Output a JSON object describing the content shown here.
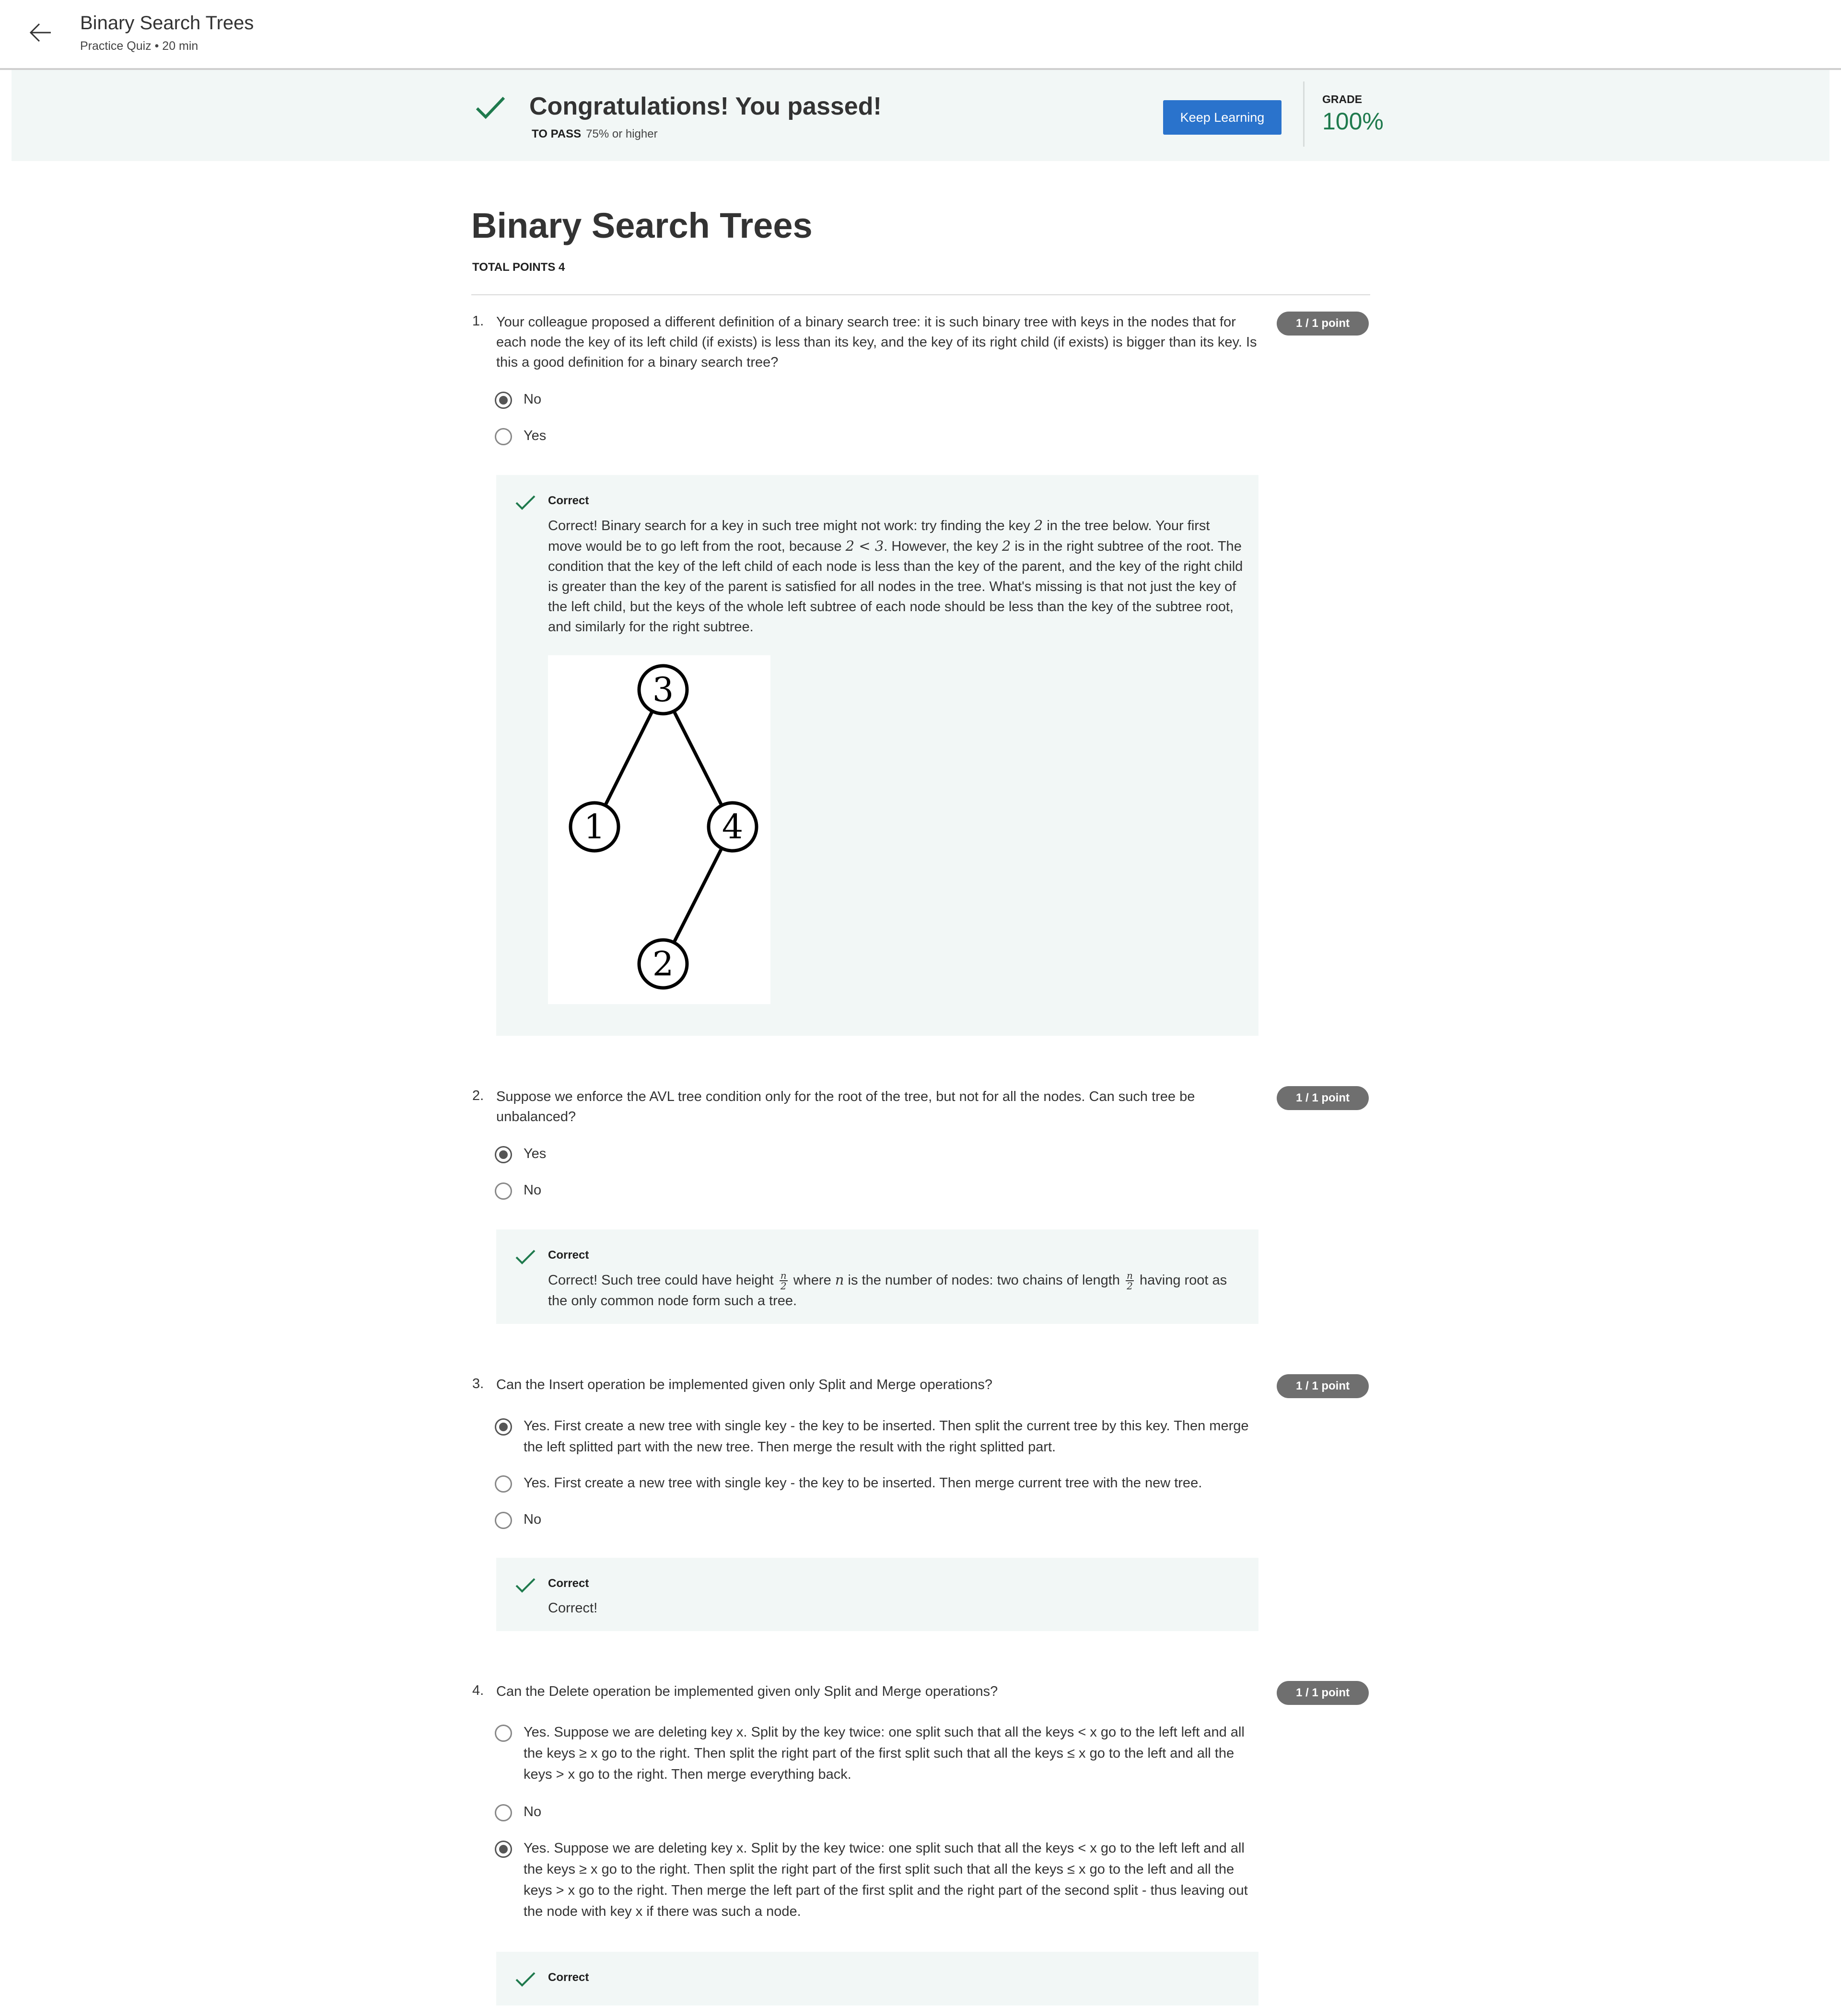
{
  "header": {
    "title": "Binary Search Trees",
    "subtitle": "Practice Quiz • 20 min"
  },
  "banner": {
    "message": "Congratulations! You passed!",
    "to_pass_label": "TO PASS",
    "to_pass_value": "75% or higher",
    "keep_learning_label": "Keep Learning",
    "grade_label": "GRADE",
    "grade_value": "100%"
  },
  "quiz": {
    "title": "Binary Search Trees",
    "total_points": "TOTAL POINTS 4"
  },
  "questions": [
    {
      "number": "1.",
      "text": "Your colleague proposed a different definition of a binary search tree: it is such binary tree with keys in the nodes that for each node the key of its left child (if exists) is less than its key, and the key of its right child (if exists) is bigger than its key. Is this a good definition for a binary search tree?",
      "points": "1 / 1 point",
      "options": [
        {
          "label": "No",
          "selected": true
        },
        {
          "label": "Yes",
          "selected": false
        }
      ],
      "feedback_label": "Correct",
      "feedback": {
        "t1": "Correct! Binary search for a key in such tree might not work: try finding the key ",
        "m1": "2",
        "t2": " in the tree below. Your first move would be to go left from the root, because ",
        "m2": "2 < 3",
        "t3": ". However, the key ",
        "m3": "2",
        "t4": " is in the right subtree of the root. The condition that the key of the left child of each node is less than the key of the parent, and the key of the right child is greater than the key of the parent is satisfied for all nodes in the tree. What's missing is that not just the key of the left child, but the keys of the whole left subtree of each node should be less than the key of the subtree root, and similarly for the right subtree."
      },
      "tree_nodes": [
        "3",
        "1",
        "4",
        "2"
      ]
    },
    {
      "number": "2.",
      "text": "Suppose we enforce the AVL tree condition only for the root of the tree, but not for all the nodes. Can such tree be unbalanced?",
      "points": "1 / 1 point",
      "options": [
        {
          "label": "Yes",
          "selected": true
        },
        {
          "label": "No",
          "selected": false
        }
      ],
      "feedback_label": "Correct",
      "feedback": {
        "t1": "Correct! Such tree could have height ",
        "num": "n",
        "den": "2",
        "t2": " where ",
        "m1": "n",
        "t3": " is the number of nodes: two chains of length ",
        "t4": " having root as the only common node form such a tree."
      }
    },
    {
      "number": "3.",
      "text": "Can the Insert operation be implemented given only Split and Merge operations?",
      "points": "1 / 1 point",
      "options": [
        {
          "label": "Yes. First create a new tree with single key - the key to be inserted. Then split the current tree by this key. Then merge the left splitted part with the new tree. Then merge the result with the right splitted part.",
          "selected": true
        },
        {
          "label": "Yes. First create a new tree with single key - the key to be inserted. Then merge current tree with the new tree.",
          "selected": false
        },
        {
          "label": "No",
          "selected": false
        }
      ],
      "feedback_label": "Correct",
      "feedback": {
        "t1": "Correct!"
      }
    },
    {
      "number": "4.",
      "text": "Can the Delete operation be implemented given only Split and Merge operations?",
      "points": "1 / 1 point",
      "options": [
        {
          "label": "Yes. Suppose we are deleting key x. Split by the key twice: one split such that all the keys < x go to the left left and all the keys ≥ x go to the right. Then split the right part of the first split such that all the keys ≤ x go to the left and all the keys > x go to the right. Then merge everything back.",
          "selected": false
        },
        {
          "label": "No",
          "selected": false
        },
        {
          "label": "Yes. Suppose we are deleting key x. Split by the key twice: one split such that all the keys < x go to the left left and all the keys ≥ x go to the right. Then split the right part of the first split such that all the keys ≤ x go to the left and all the keys > x go to the right. Then merge the left part of the first split and the right part of the second split - thus leaving out the node with key x if there was such a node.",
          "selected": true
        }
      ],
      "feedback_label": "Correct"
    }
  ]
}
